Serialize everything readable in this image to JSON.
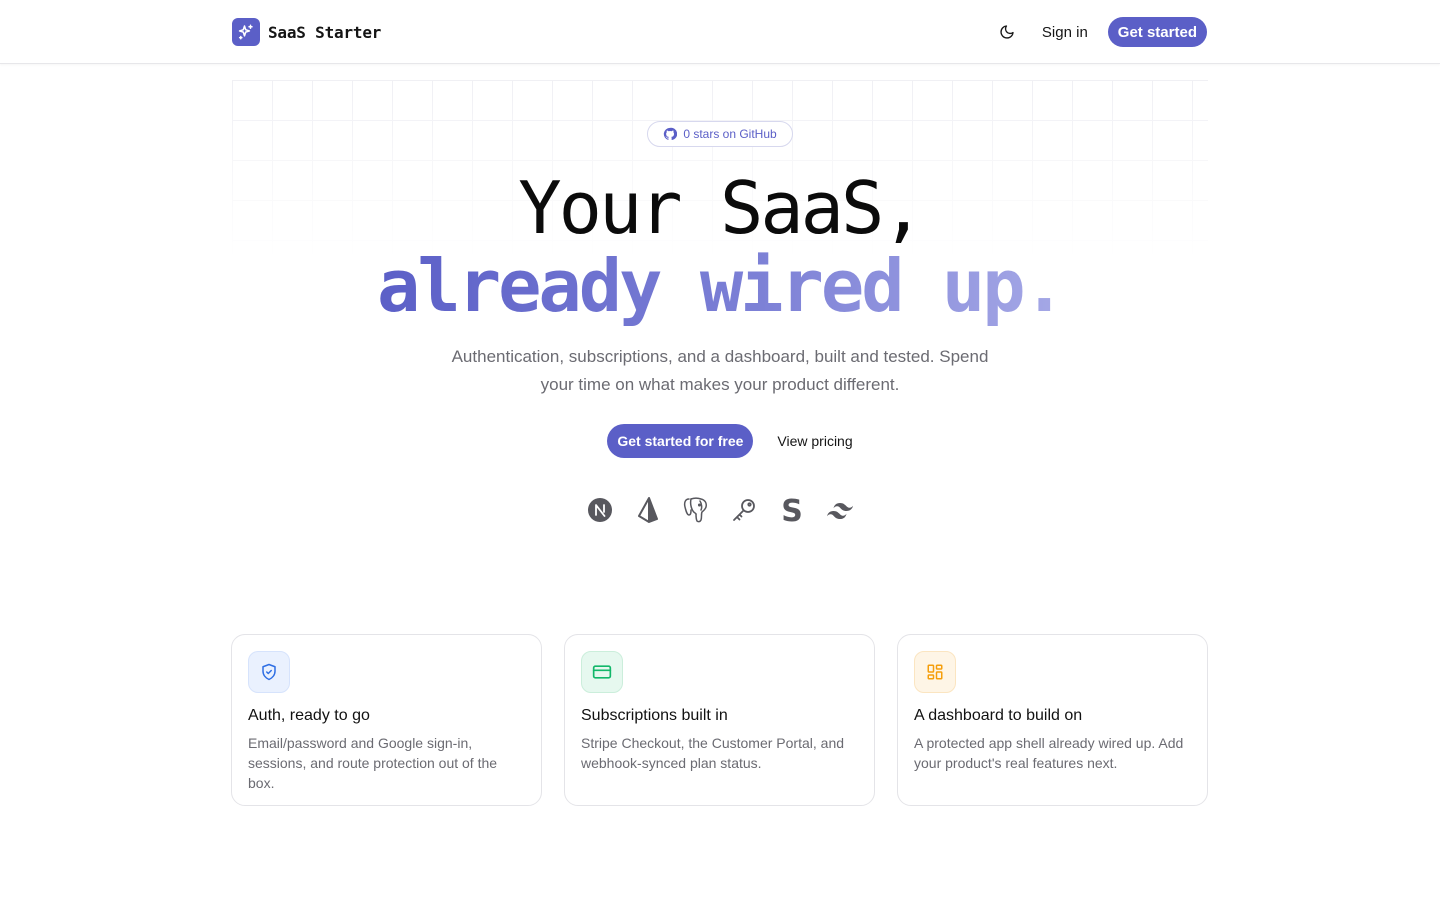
{
  "header": {
    "brand_name": "SaaS Starter",
    "sign_in": "Sign in",
    "get_started": "Get started"
  },
  "hero": {
    "github_badge": "0 stars on GitHub",
    "title_line1": "Your SaaS,",
    "title_line2": "already wired up.",
    "subtitle": "Authentication, subscriptions, and a dashboard, built and tested. Spend your time on what makes your product different.",
    "cta_primary": "Get started for free",
    "cta_secondary": "View pricing",
    "tech_stack_icons": [
      "nextjs-icon",
      "prisma-icon",
      "postgresql-icon",
      "auth-key-icon",
      "stripe-icon",
      "tailwind-icon"
    ]
  },
  "features": [
    {
      "icon": "shield-check-icon",
      "title": "Auth, ready to go",
      "text": "Email/password and Google sign-in, sessions, and route protection out of the box."
    },
    {
      "icon": "credit-card-icon",
      "title": "Subscriptions built in",
      "text": "Stripe Checkout, the Customer Portal, and webhook-synced plan status."
    },
    {
      "icon": "dashboard-grid-icon",
      "title": "A dashboard to build on",
      "text": "A protected app shell already wired up. Add your product's real features next."
    }
  ],
  "colors": {
    "accent": "#5b5fc7",
    "accent_light": "#a5a8e6",
    "text": "#111111",
    "muted": "#6b6b72",
    "feature_blue": "#2f6fe4",
    "feature_green": "#12b76a",
    "feature_amber": "#f59e0b"
  }
}
